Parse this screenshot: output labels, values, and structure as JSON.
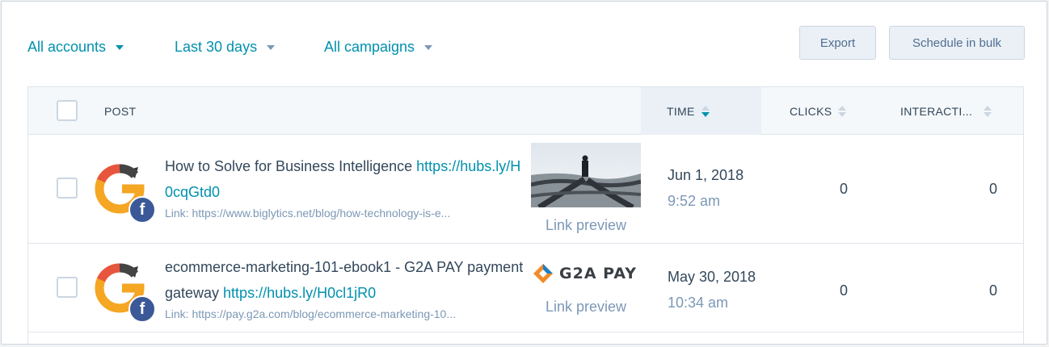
{
  "filters": {
    "accounts": "All accounts",
    "range": "Last 30 days",
    "campaigns": "All campaigns"
  },
  "actions": {
    "export": "Export",
    "schedule": "Schedule in bulk"
  },
  "table": {
    "columns": {
      "post": "POST",
      "time": "TIME",
      "clicks": "CLICKS",
      "interactions": "INTERACTI..."
    },
    "rows": [
      {
        "text": "How to Solve for Business Intelligence ",
        "short_link": "https://hubs.ly/H0cqGtd0",
        "link_line": "Link: https://www.biglytics.net/blog/how-technology-is-e...",
        "preview_label": "Link preview",
        "date": "Jun 1, 2018",
        "time": "9:52 am",
        "clicks": "0",
        "interactions": "0"
      },
      {
        "text": "ecommerce-marketing-101-ebook1 - G2A PAY payment gateway ",
        "short_link": "https://hubs.ly/H0cl1jR0",
        "link_line": "Link: https://pay.g2a.com/blog/ecommerce-marketing-10...",
        "preview_label": "Link preview",
        "logo_text": "G2A PAY",
        "date": "May 30, 2018",
        "time": "10:34 am",
        "clicks": "0",
        "interactions": "0"
      }
    ]
  },
  "icons": {
    "network": "facebook-icon",
    "network_glyph": "f"
  },
  "colors": {
    "accent": "#0091ae",
    "text": "#33475b",
    "muted": "#7c98b6",
    "facebook": "#3b5998"
  }
}
